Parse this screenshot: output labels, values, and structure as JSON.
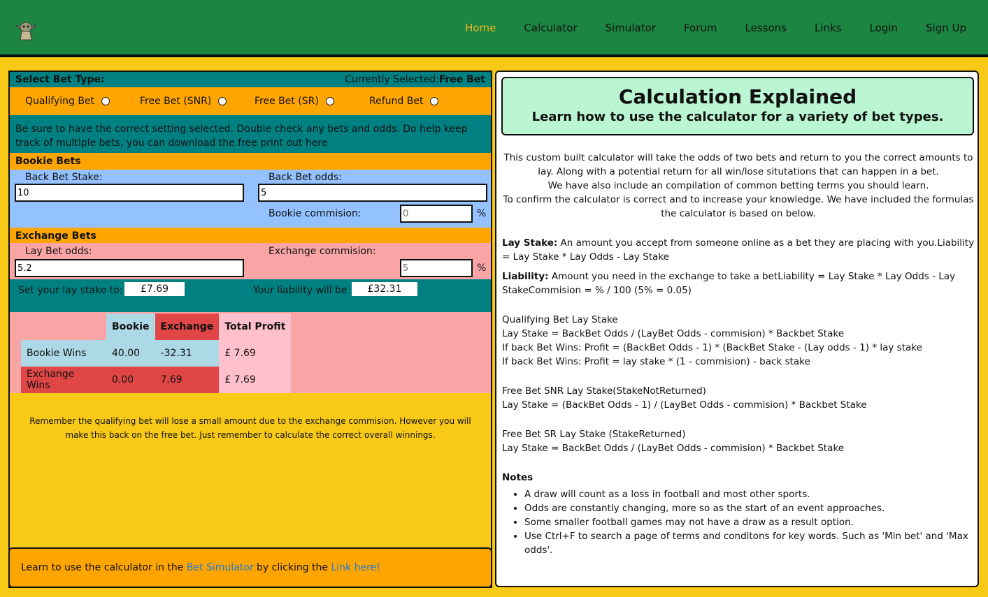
{
  "nav": {
    "logo_icon": "yoda-character-icon",
    "links": [
      "Home",
      "Calculator",
      "Simulator",
      "Forum",
      "Lessons",
      "Links",
      "Login",
      "Sign Up"
    ],
    "active": "Home"
  },
  "calculator": {
    "select_label": "Select Bet Type:",
    "current_label": "Currently Selected:",
    "current_value": "Free Bet",
    "options": [
      "Qualifying Bet",
      "Free Bet (SNR)",
      "Free Bet (SR)",
      "Refund Bet"
    ],
    "info": "Be sure to have the correct setting selected. Double check any bets and odds. Do help keep track of multiple bets, you can download the free print out here",
    "bookie": {
      "heading": "Bookie Bets",
      "stake_label": "Back Bet Stake:",
      "stake_value": "10",
      "odds_label": "Back Bet odds:",
      "odds_value": "5",
      "commission_label": "Bookie commision:",
      "commission_placeholder": "0",
      "pct": "%"
    },
    "exchange": {
      "heading": "Exchange Bets",
      "odds_label": "Lay Bet odds:",
      "odds_value": "5.2",
      "commission_label": "Exchange commision:",
      "commission_placeholder": "5",
      "pct": "%"
    },
    "result": {
      "lay_label": "Set your lay stake to:",
      "lay_value": "£7.69",
      "liability_label": "Your liability will be",
      "liability_value": "£32.31"
    },
    "table": {
      "headers": [
        "",
        "Bookie",
        "Exchange",
        "Total Profit"
      ],
      "rows": [
        [
          "Bookie Wins",
          "40.00",
          "-32.31",
          "£ 7.69"
        ],
        [
          "Exchange Wins",
          "0.00",
          "7.69",
          "£ 7.69"
        ]
      ]
    },
    "note": "Remember the qualifying bet will lose a small amount due to the exchange commision. However you will make this back on the free bet. Just remember to calculate the correct overall winnings.",
    "footer": {
      "pre": "Learn to use the calculator in the ",
      "link1": "Bet Simulator",
      "mid": " by clicking the ",
      "link2": "Link here!"
    }
  },
  "explained": {
    "title": "Calculation Explained",
    "subtitle": "Learn how to use the calculator for a variety of bet types.",
    "intro": [
      "This custom built calculator will take the odds of two bets and return to you the correct amounts to lay. Along with a potential return for all win/lose situtations that can happen in a bet.",
      "We have also include an compilation of common betting terms you should learn.",
      "To confirm the calculator is correct and to increase your knowledge. We have included the formulas the calculator is based on below."
    ],
    "lay_stake_term": "Lay Stake:",
    "lay_stake_text": " An amount you accept from someone online as a bet they are placing with you.Liability = Lay Stake * Lay Odds - Lay Stake",
    "liability_term": "Liability:",
    "liability_text": " Amount you need in the exchange to take a betLiability = Lay Stake * Lay Odds - Lay StakeCommision = % / 100 (5% = 0.05)",
    "qualifying": [
      "Qualifying Bet Lay Stake",
      "Lay Stake = BackBet Odds / (LayBet Odds - commision) * Backbet Stake",
      "If back Bet Wins: Profit = (BackBet Odds - 1) * (BackBet Stake - (Lay odds - 1) * lay stake",
      "If back Bet Wins: Profit = lay stake * (1 - commision) - back stake"
    ],
    "snr": [
      "Free Bet SNR Lay Stake(StakeNotReturned)",
      "Lay Stake = (BackBet Odds - 1) / (LayBet Odds - commision) * Backbet Stake"
    ],
    "sr": [
      "Free Bet SR Lay Stake (StakeReturned)",
      "Lay Stake = BackBet Odds / (LayBet Odds - commision) * Backbet Stake"
    ],
    "notes_heading": "Notes",
    "notes": [
      "A draw will count as a loss in football and most other sports.",
      "Odds are constantly changing, more so as the start of an event approaches.",
      "Some smaller football games may not have a draw as a result option.",
      "Use Ctrl+F to search a page of terms and conditons for key words. Such as 'Min bet' and 'Max odds'."
    ]
  }
}
